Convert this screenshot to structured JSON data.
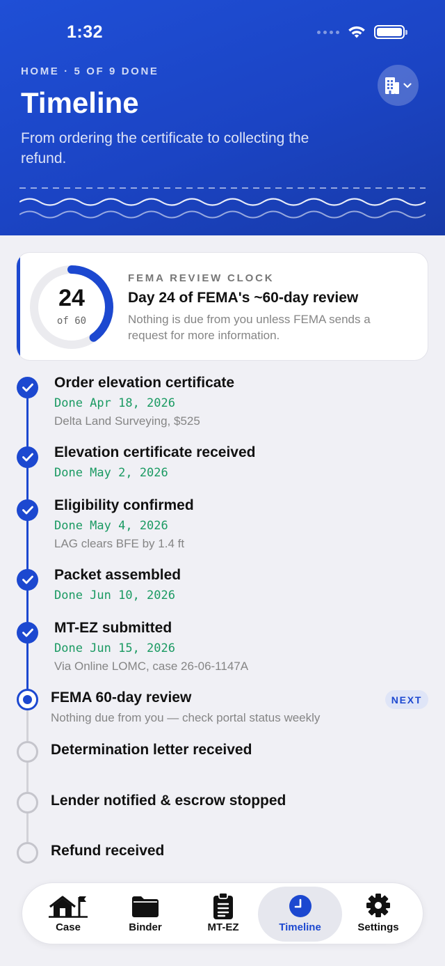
{
  "status_bar": {
    "time": "1:32"
  },
  "header": {
    "eyebrow": "HOME · 5 OF 9 DONE",
    "title": "Timeline",
    "subtitle": "From ordering the certificate to collecting the refund."
  },
  "review_clock": {
    "eyebrow": "FEMA REVIEW CLOCK",
    "day": "24",
    "of_label": "of 60",
    "progress_fraction": 0.4,
    "title": "Day 24 of FEMA's ~60-day review",
    "description": "Nothing is due from you unless FEMA sends a request for more information."
  },
  "steps": [
    {
      "title": "Order elevation certificate",
      "date": "Done Apr 18, 2026",
      "note": "Delta Land Surveying, $525",
      "status": "done"
    },
    {
      "title": "Elevation certificate received",
      "date": "Done May 2, 2026",
      "note": "",
      "status": "done"
    },
    {
      "title": "Eligibility confirmed",
      "date": "Done May 4, 2026",
      "note": "LAG clears BFE by 1.4 ft",
      "status": "done"
    },
    {
      "title": "Packet assembled",
      "date": "Done Jun 10, 2026",
      "note": "",
      "status": "done"
    },
    {
      "title": "MT-EZ submitted",
      "date": "Done Jun 15, 2026",
      "note": "Via Online LOMC, case 26-06-1147A",
      "status": "done"
    },
    {
      "title": "FEMA 60-day review",
      "date": "",
      "note": "Nothing due from you — check portal status weekly",
      "status": "current",
      "badge": "NEXT"
    },
    {
      "title": "Determination letter received",
      "date": "",
      "note": "",
      "status": "pending"
    },
    {
      "title": "Lender notified & escrow stopped",
      "date": "",
      "note": "",
      "status": "pending"
    },
    {
      "title": "Refund received",
      "date": "",
      "note": "",
      "status": "pending"
    }
  ],
  "tabbar": {
    "tabs": [
      {
        "label": "Case",
        "icon": "house-flag-icon"
      },
      {
        "label": "Binder",
        "icon": "folder-icon"
      },
      {
        "label": "MT-EZ",
        "icon": "clipboard-icon"
      },
      {
        "label": "Timeline",
        "icon": "clock-icon",
        "active": true
      },
      {
        "label": "Settings",
        "icon": "gear-icon"
      }
    ]
  },
  "colors": {
    "accent": "#1c48d0",
    "done_green": "#1a9a62",
    "header_blue": "#1f4fd6"
  }
}
